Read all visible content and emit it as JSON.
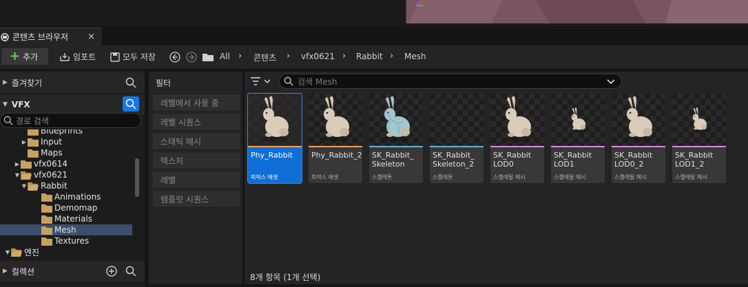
{
  "tab": {
    "title": "콘텐츠 브라우저",
    "close": "×"
  },
  "toolbar": {
    "add_label": "추가",
    "import_label": "임포트",
    "save_all_label": "모두 저장",
    "breadcrumb": [
      "All",
      "콘텐츠",
      "vfx0621",
      "Rabbit",
      "Mesh"
    ]
  },
  "left": {
    "favorites_label": "즐겨찾기",
    "root_label": "VFX",
    "search_placeholder": "경로 검색",
    "tree": [
      {
        "label": "Blueprints",
        "indent": 2,
        "expander": "",
        "selected": false
      },
      {
        "label": "Input",
        "indent": 2,
        "expander": "▶",
        "selected": false
      },
      {
        "label": "Maps",
        "indent": 2,
        "expander": "",
        "selected": false
      },
      {
        "label": "vfx0614",
        "indent": 1,
        "expander": "▶",
        "selected": false
      },
      {
        "label": "vfx0621",
        "indent": 1,
        "expander": "▼",
        "selected": false
      },
      {
        "label": "Rabbit",
        "indent": 2,
        "expander": "▼",
        "selected": false
      },
      {
        "label": "Animations",
        "indent": 3,
        "expander": "",
        "selected": false
      },
      {
        "label": "Demomap",
        "indent": 3,
        "expander": "",
        "selected": false
      },
      {
        "label": "Materials",
        "indent": 3,
        "expander": "",
        "selected": false
      },
      {
        "label": "Mesh",
        "indent": 3,
        "expander": "",
        "selected": true
      },
      {
        "label": "Textures",
        "indent": 3,
        "expander": "",
        "selected": false
      },
      {
        "label": "엔진",
        "indent": 0,
        "expander": "▼",
        "selected": false
      }
    ],
    "collections_label": "컬렉션"
  },
  "filters": {
    "title": "필터",
    "items": [
      "레벨에서 사용 중",
      "레벨 시퀀스",
      "스태틱 메시",
      "텍스처",
      "레벨",
      "템플릿 시퀀스"
    ]
  },
  "assets": {
    "search_placeholder": "검색 Mesh",
    "tiles": [
      {
        "name": "Phy_Rabbit",
        "type": "피직스 에셋",
        "stripe": "#f0a060",
        "selected": true,
        "rabbit": "large"
      },
      {
        "name": "Phy_Rabbit_2",
        "type": "피직스 에셋",
        "stripe": "#f0a060",
        "selected": false,
        "rabbit": "large"
      },
      {
        "name": "SK_Rabbit_\nSkeleton",
        "type": "스켈레톤",
        "stripe": "#6ab0e0",
        "selected": false,
        "rabbit": "skeleton"
      },
      {
        "name": "SK_Rabbit_\nSkeleton_2",
        "type": "스켈레톤",
        "stripe": "#6ab0e0",
        "selected": false,
        "rabbit": "none"
      },
      {
        "name": "SK_Rabbit\nLOD0",
        "type": "스켈레탈 메시",
        "stripe": "#e08ae8",
        "selected": false,
        "rabbit": "large"
      },
      {
        "name": "SK_Rabbit\nLOD1",
        "type": "스켈레탈 메시",
        "stripe": "#e08ae8",
        "selected": false,
        "rabbit": "small"
      },
      {
        "name": "SK_Rabbit\nLOD0_2",
        "type": "스켈레탈 메시",
        "stripe": "#e08ae8",
        "selected": false,
        "rabbit": "large"
      },
      {
        "name": "SK_Rabbit\nLOD1_2",
        "type": "스켈레탈 메시",
        "stripe": "#e08ae8",
        "selected": false,
        "rabbit": "small"
      }
    ]
  },
  "status": "8개 항목 (1개 선택)",
  "colors": {
    "accent": "#0f6fd6",
    "add_plus": "#6fcf4a",
    "folder": "#c8a060"
  }
}
